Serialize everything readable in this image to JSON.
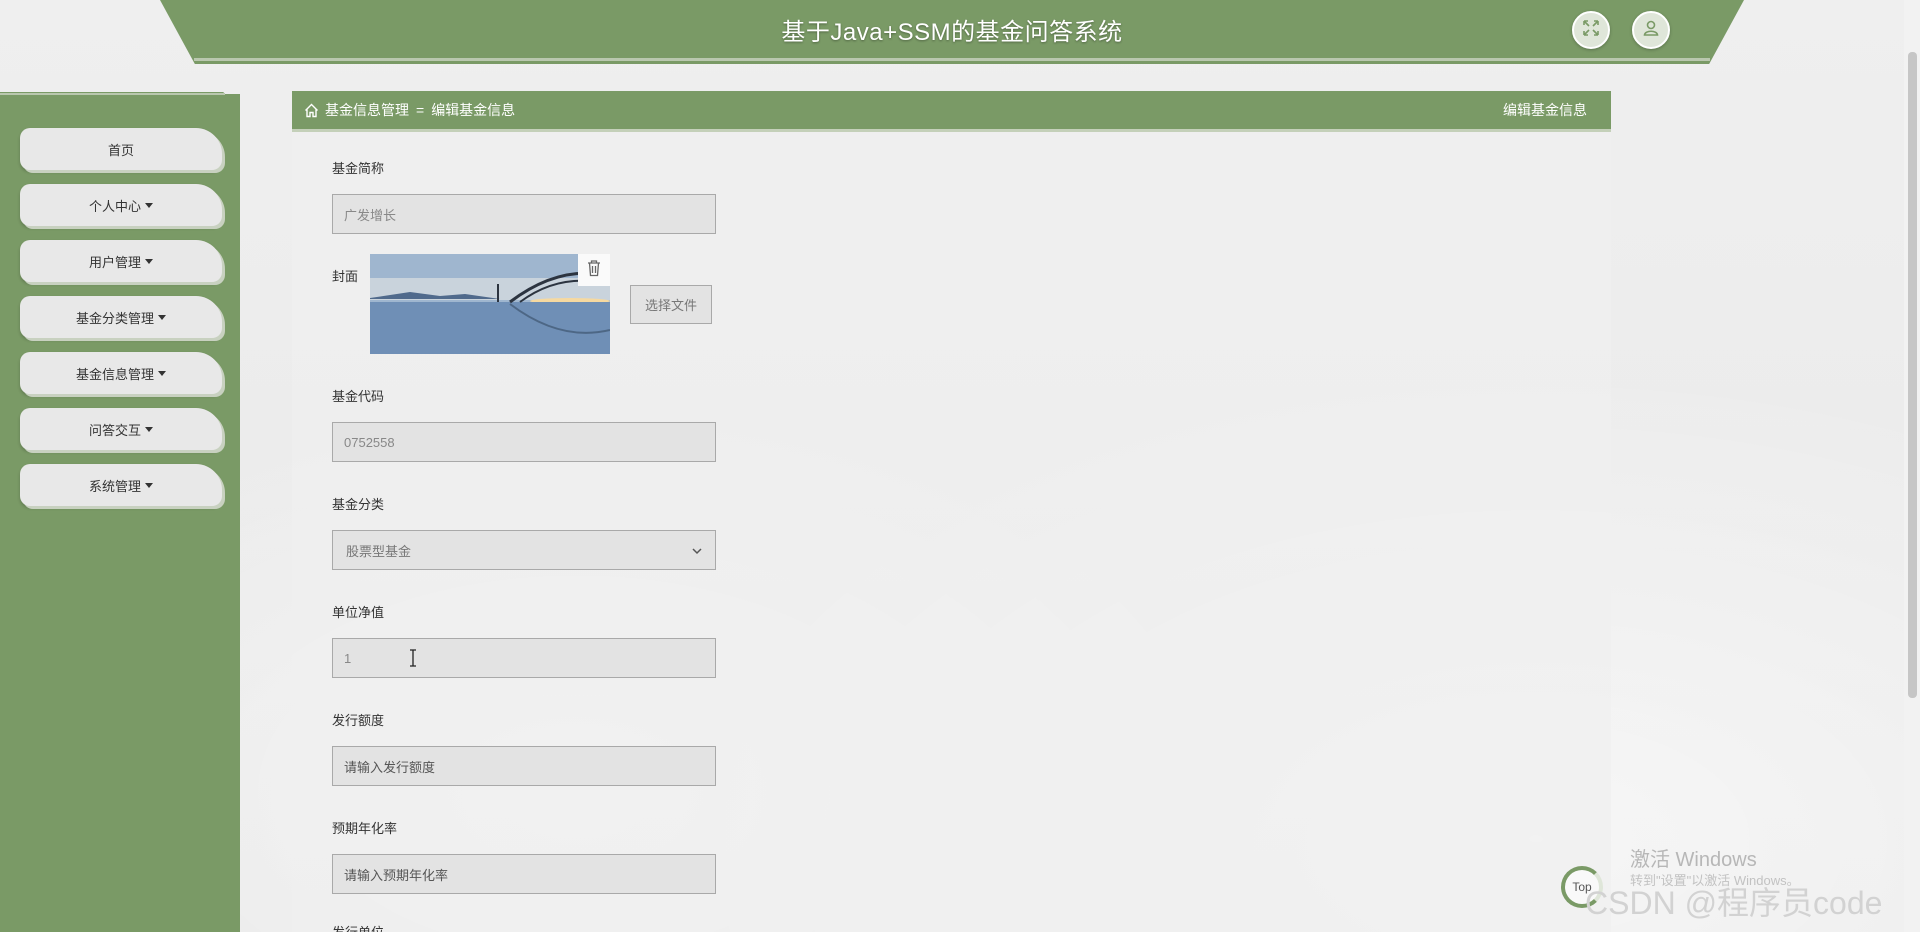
{
  "app": {
    "title": "基于Java+SSM的基金问答系统",
    "accent": "#7a9a66"
  },
  "header": {
    "fullscreen_icon": "expand-icon",
    "user_icon": "user-icon"
  },
  "sidebar": {
    "items": [
      {
        "label": "首页",
        "has_caret": false
      },
      {
        "label": "个人中心",
        "has_caret": true
      },
      {
        "label": "用户管理",
        "has_caret": true
      },
      {
        "label": "基金分类管理",
        "has_caret": true
      },
      {
        "label": "基金信息管理",
        "has_caret": true
      },
      {
        "label": "问答交互",
        "has_caret": true
      },
      {
        "label": "系统管理",
        "has_caret": true
      }
    ]
  },
  "breadcrumb": {
    "home_icon": "home-icon",
    "parent": "基金信息管理",
    "separator": "=",
    "current": "编辑基金信息",
    "right_title": "编辑基金信息"
  },
  "form": {
    "fund_short_name": {
      "label": "基金简称",
      "value": "广发增长"
    },
    "cover": {
      "label": "封面",
      "file_button": "选择文件",
      "delete_icon": "trash-icon"
    },
    "fund_code": {
      "label": "基金代码",
      "value": "0752558"
    },
    "fund_category": {
      "label": "基金分类",
      "selected": "股票型基金"
    },
    "nav": {
      "label": "单位净值",
      "value": "1"
    },
    "issue_amount": {
      "label": "发行额度",
      "placeholder": "请输入发行额度"
    },
    "expected_annual_rate": {
      "label": "预期年化率",
      "placeholder": "请输入预期年化率"
    },
    "next_label": "发行单位"
  },
  "overlay": {
    "top_button": "Top",
    "activate_windows": "激活 Windows",
    "activate_hint": "转到\"设置\"以激活 Windows。",
    "csdn_watermark": "CSDN @程序员code"
  }
}
